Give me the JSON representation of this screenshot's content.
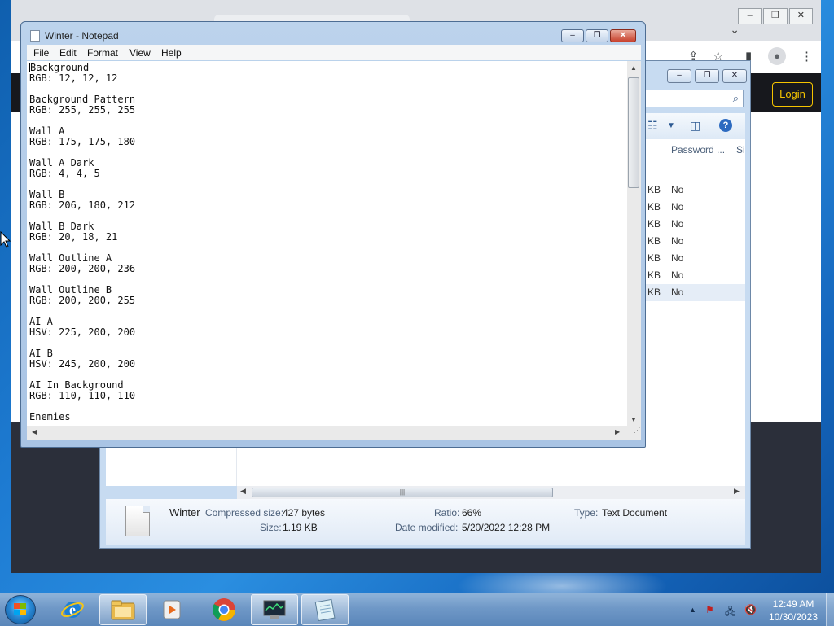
{
  "browser": {
    "login_label": "Login"
  },
  "explorer": {
    "column_password": "Password ...",
    "column_size_partial": "Si",
    "rows": [
      {
        "size_unit": "KB",
        "password": "No"
      },
      {
        "size_unit": "KB",
        "password": "No"
      },
      {
        "size_unit": "KB",
        "password": "No"
      },
      {
        "size_unit": "KB",
        "password": "No"
      },
      {
        "size_unit": "KB",
        "password": "No"
      },
      {
        "size_unit": "KB",
        "password": "No"
      },
      {
        "size_unit": "KB",
        "password": "No"
      }
    ],
    "details": {
      "file_name": "Winter",
      "compressed_label": "Compressed size:",
      "compressed_value": "427 bytes",
      "size_label": "Size:",
      "size_value": "1.19 KB",
      "ratio_label": "Ratio:",
      "ratio_value": "66%",
      "modified_label": "Date modified:",
      "modified_value": "5/20/2022 12:28 PM",
      "type_label": "Type:",
      "type_value": "Text Document"
    }
  },
  "notepad": {
    "title": "Winter - Notepad",
    "menu": [
      "File",
      "Edit",
      "Format",
      "View",
      "Help"
    ],
    "first_char": "B",
    "content_rest": "ackground\nRGB: 12, 12, 12\n\nBackground Pattern\nRGB: 255, 255, 255\n\nWall A\nRGB: 175, 175, 180\n\nWall A Dark\nRGB: 4, 4, 5\n\nWall B\nRGB: 206, 180, 212\n\nWall B Dark\nRGB: 20, 18, 21\n\nWall Outline A\nRGB: 200, 200, 236\n\nWall Outline B\nRGB: 200, 200, 255\n\nAI A\nHSV: 225, 200, 200\n\nAI B\nHSV: 245, 200, 200\n\nAI In Background\nRGB: 110, 110, 110\n\nEnemies"
  },
  "taskbar": {
    "pinned": [
      "internet-explorer-icon",
      "file-explorer-icon",
      "media-center-icon",
      "chrome-icon",
      "task-manager-icon",
      "notepad-icon"
    ],
    "clock_time": "12:49 AM",
    "clock_date": "10/30/2023"
  },
  "colors": {
    "accent_yellow": "#f5c400",
    "close_red": "#c8412d",
    "taskbar_blue": "#6f98c7"
  }
}
